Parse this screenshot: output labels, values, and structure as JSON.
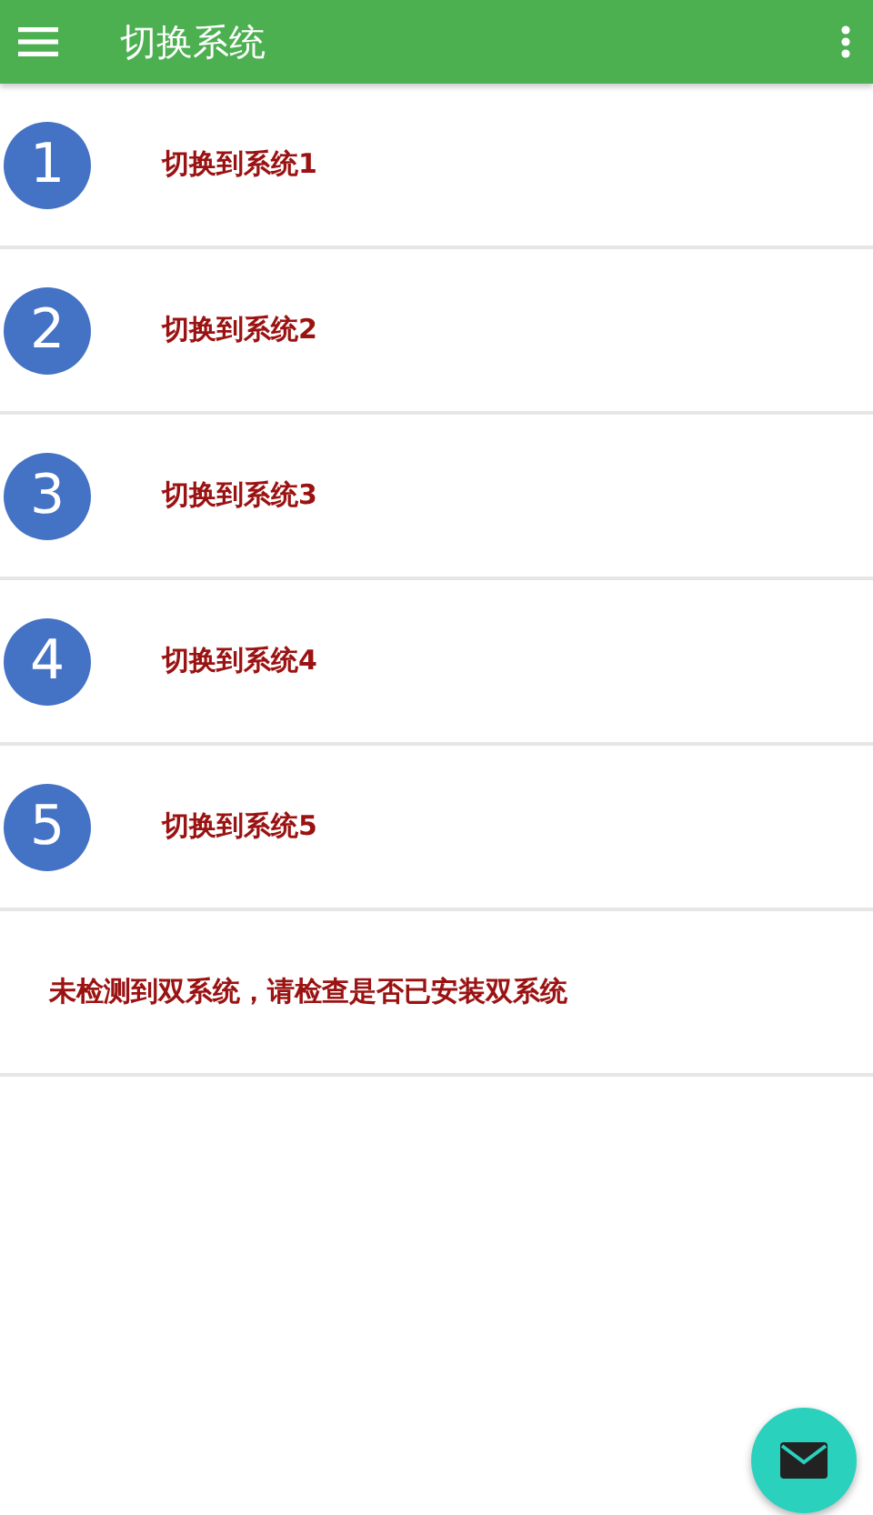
{
  "app_bar": {
    "title": "切换系统"
  },
  "items": [
    {
      "number": "1",
      "label": "切换到系统1"
    },
    {
      "number": "2",
      "label": "切换到系统2"
    },
    {
      "number": "3",
      "label": "切换到系统3"
    },
    {
      "number": "4",
      "label": "切换到系统4"
    },
    {
      "number": "5",
      "label": "切换到系统5"
    }
  ],
  "message": "未检测到双系统，请检查是否已安装双系统"
}
